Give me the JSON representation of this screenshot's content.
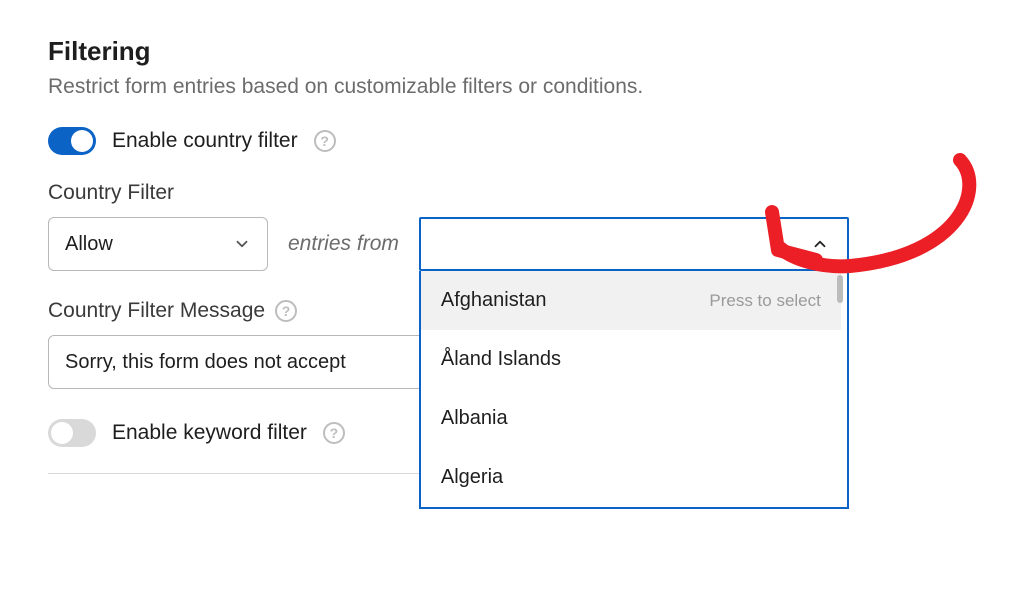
{
  "section": {
    "title": "Filtering",
    "description": "Restrict form entries based on customizable filters or conditions."
  },
  "country_filter_toggle": {
    "label": "Enable country filter",
    "enabled": true
  },
  "country_filter": {
    "label": "Country Filter",
    "mode_value": "Allow",
    "entries_from_text": "entries from",
    "dropdown": {
      "options": [
        "Afghanistan",
        "Åland Islands",
        "Albania",
        "Algeria"
      ],
      "select_hint": "Press to select"
    }
  },
  "message": {
    "label": "Country Filter Message",
    "value": "Sorry, this form does not accept"
  },
  "keyword_filter_toggle": {
    "label": "Enable keyword filter",
    "enabled": false
  },
  "help_glyph": "?"
}
